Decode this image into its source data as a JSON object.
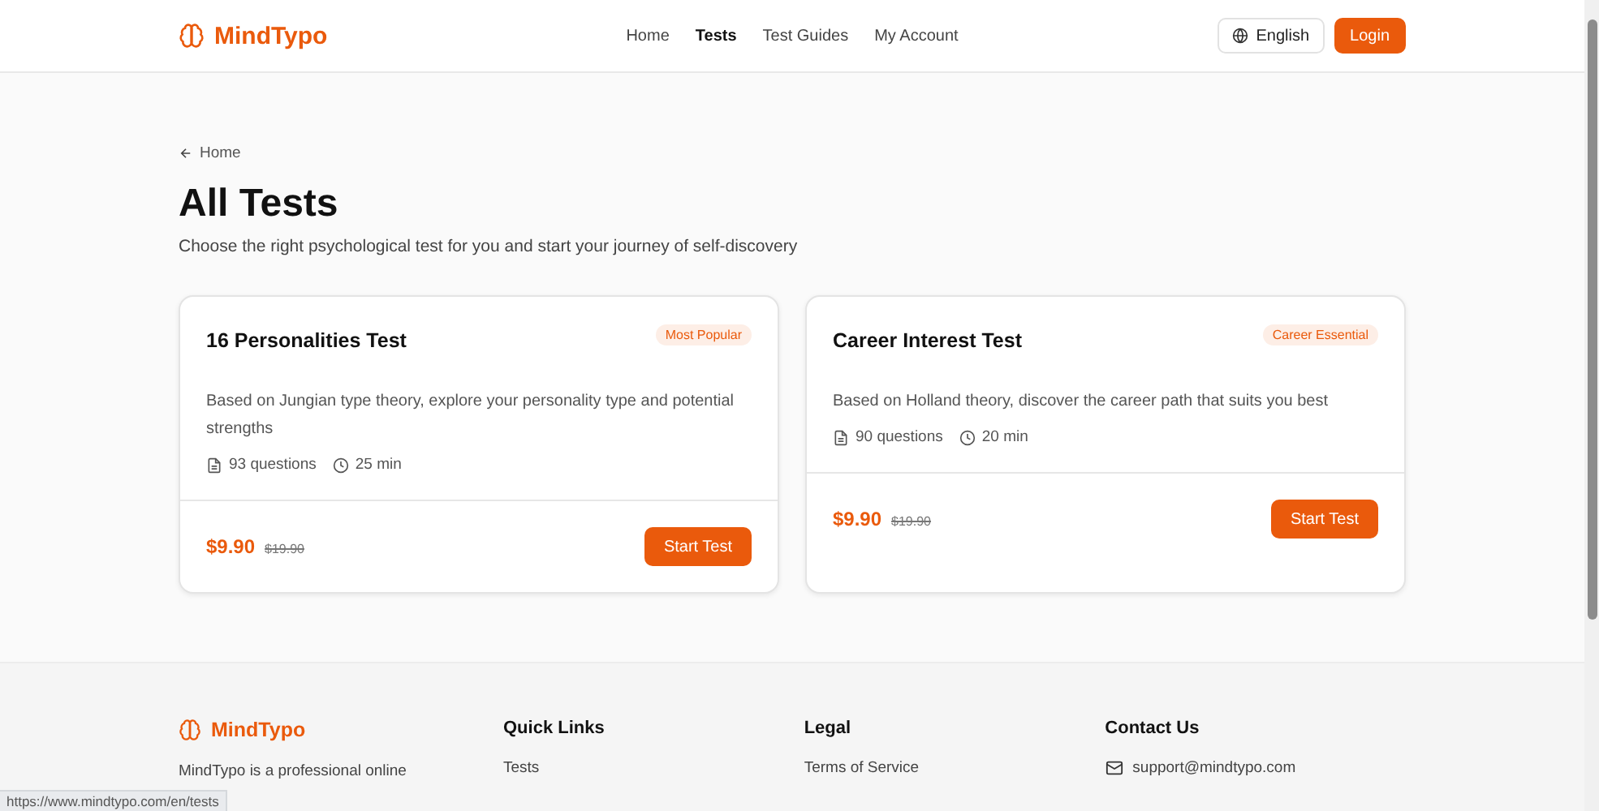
{
  "header": {
    "logo": "MindTypo",
    "nav": [
      {
        "label": "Home",
        "selected": false
      },
      {
        "label": "Tests",
        "selected": true
      },
      {
        "label": "Test Guides",
        "selected": false
      },
      {
        "label": "My Account",
        "selected": false
      }
    ],
    "language": "English",
    "login": "Login"
  },
  "back_link": "Home",
  "title": "All Tests",
  "subtitle": "Choose the right psychological test for you and start your journey of self-discovery",
  "tests": [
    {
      "name": "16 Personalities Test",
      "badge": "Most Popular",
      "description": "Based on Jungian type theory, explore your personality type and potential strengths",
      "questions": "93 questions",
      "duration": "25 min",
      "price": "$9.90",
      "old_price": "$19.90",
      "button": "Start Test"
    },
    {
      "name": "Career Interest Test",
      "badge": "Career Essential",
      "description": "Based on Holland theory, discover the career path that suits you best",
      "questions": "90 questions",
      "duration": "20 min",
      "price": "$9.90",
      "old_price": "$19.90",
      "button": "Start Test"
    }
  ],
  "footer": {
    "logo": "MindTypo",
    "about": "MindTypo is a professional online",
    "columns": [
      {
        "title": "Quick Links",
        "links": [
          "Tests"
        ]
      },
      {
        "title": "Legal",
        "links": [
          "Terms of Service"
        ]
      }
    ],
    "contact": {
      "title": "Contact Us",
      "email": "support@mindtypo.com"
    }
  },
  "status_url": "https://www.mindtypo.com/en/tests"
}
